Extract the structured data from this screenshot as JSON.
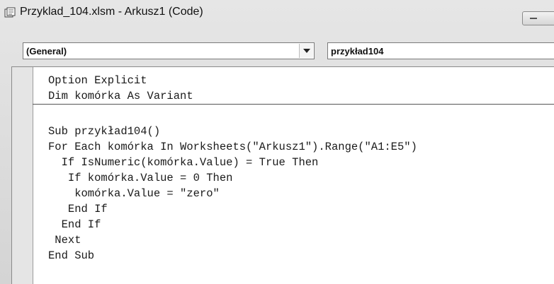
{
  "window": {
    "title": "Przyklad_104.xlsm - Arkusz1 (Code)",
    "icon": "vba-module-icon"
  },
  "object_combo": {
    "selected": "(General)"
  },
  "procedure_combo": {
    "selected": "przykład104"
  },
  "code": {
    "declarations": [
      "Option Explicit",
      "Dim komórka As Variant"
    ],
    "procedure": [
      "Sub przykład104()",
      "For Each komórka In Worksheets(\"Arkusz1\").Range(\"A1:E5\")",
      "  If IsNumeric(komórka.Value) = True Then",
      "   If komórka.Value = 0 Then",
      "    komórka.Value = \"zero\"",
      "   End If",
      "  End If",
      " Next",
      "End Sub"
    ]
  }
}
